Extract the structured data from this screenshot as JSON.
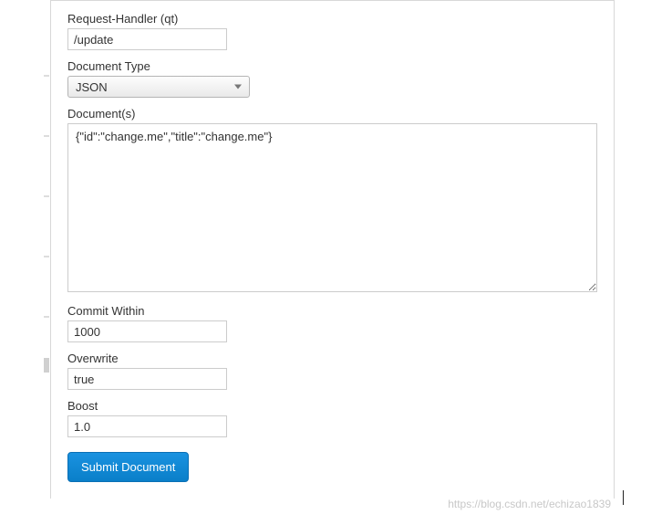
{
  "form": {
    "requestHandler": {
      "label": "Request-Handler (qt)",
      "value": "/update"
    },
    "documentType": {
      "label": "Document Type",
      "value": "JSON"
    },
    "documents": {
      "label": "Document(s)",
      "value": "{\"id\":\"change.me\",\"title\":\"change.me\"}"
    },
    "commitWithin": {
      "label": "Commit Within",
      "value": "1000"
    },
    "overwrite": {
      "label": "Overwrite",
      "value": "true"
    },
    "boost": {
      "label": "Boost",
      "value": "1.0"
    },
    "submit": {
      "label": "Submit Document"
    }
  },
  "watermark": "https://blog.csdn.net/echizao1839"
}
